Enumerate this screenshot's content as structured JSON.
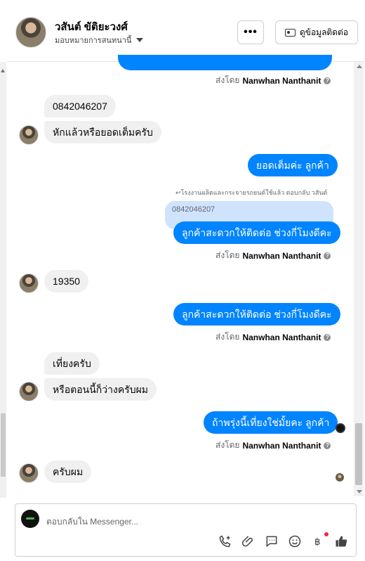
{
  "header": {
    "name": "วสันต์ ขัติยะวงศ์",
    "subtitle": "มอบหมายการสนทนานี้",
    "more_label": "•••",
    "contact_label": "ดูข้อมูลติดต่อ"
  },
  "sent_by_prefix": "ส่งโดย",
  "sent_by_name": "Nanwhan Nanthanit",
  "messages": {
    "m1": "0842046207",
    "m2": "หักแล้วหรือยอดเต็มครับ",
    "m3": "ยอดเต็มค่ะ ลูกค้า",
    "reply_note": "โรงงานผลิตและกระจายรถยนต์ใช้แล้ว ตอบกลับ วสันต์",
    "quoted": "0842046207",
    "m4": "ลูกค้าสะดวกให้ติดต่อ ช่วงกี่โมงดีคะ",
    "m5": "19350",
    "m6": "ลูกค้าสะดวกให้ติดต่อ ช่วงกี่โมงดีคะ",
    "m7": "เที่ยงครับ",
    "m8": "หรือตอนนี้ก็ว่างครับผม",
    "m9": "ถ้าพรุ่งนี้เที่ยงใช่มั้ยคะ ลูกค้า",
    "m10": "ครับผม"
  },
  "composer": {
    "placeholder": "ตอบกลับใน Messenger..."
  },
  "colors": {
    "outgoing": "#0084ff",
    "incoming": "#f0f0f0",
    "notification": "#f02849"
  },
  "icons": [
    "phone-plus-icon",
    "attachment-icon",
    "saved-reply-icon",
    "emoji-icon",
    "baht-icon",
    "thumbs-up-icon"
  ]
}
